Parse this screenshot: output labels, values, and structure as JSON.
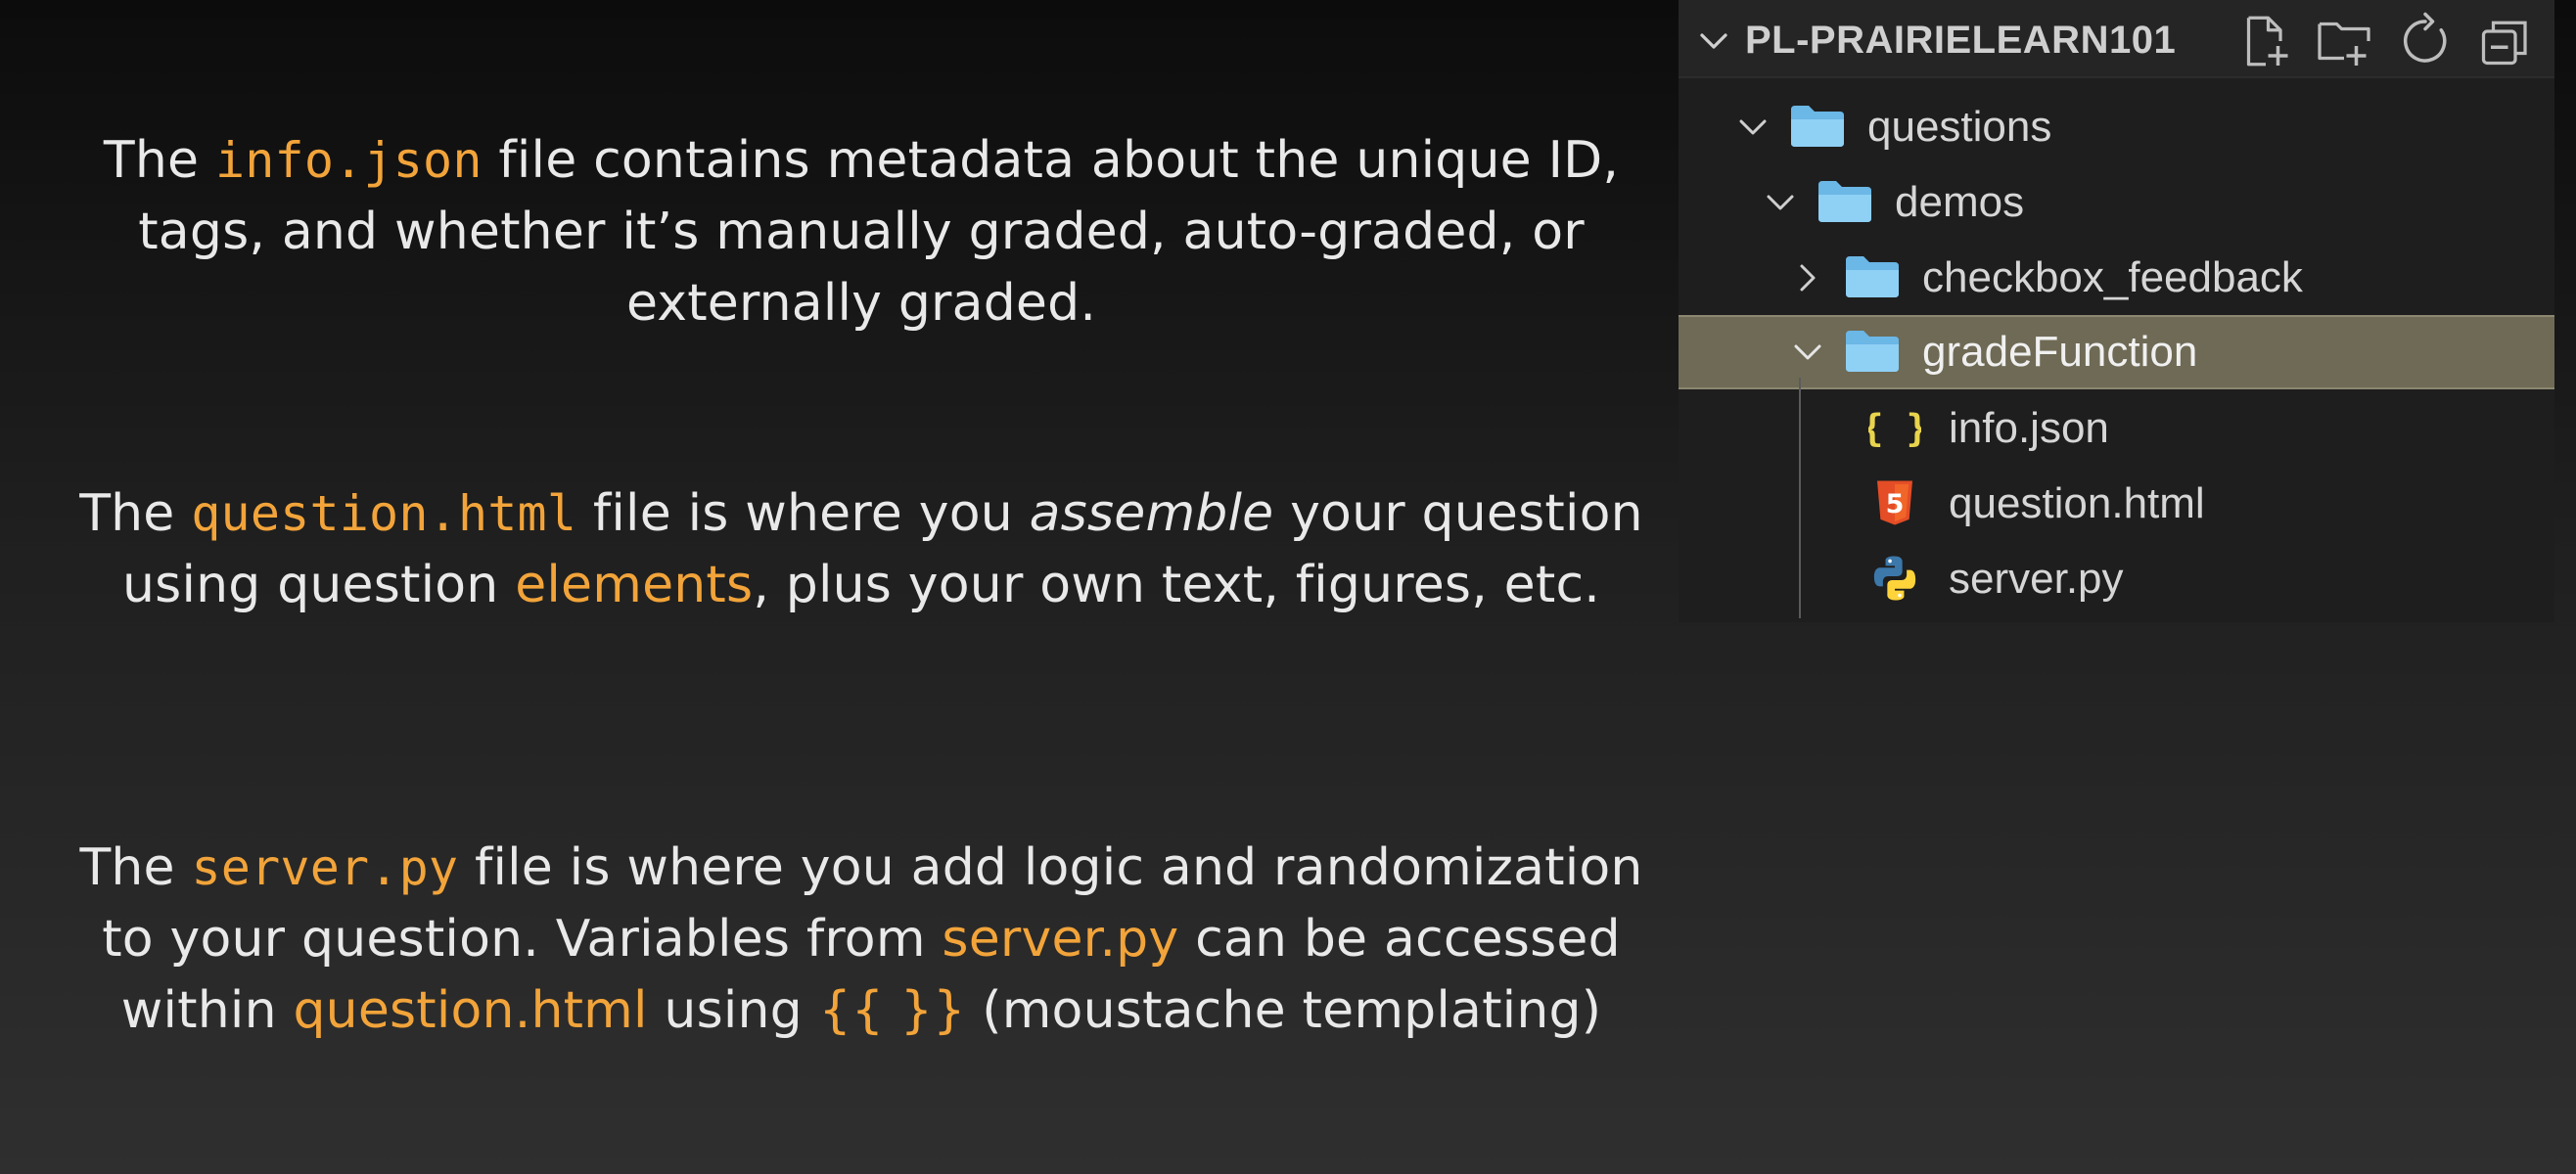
{
  "slide": {
    "info": {
      "p1": "The ",
      "code": "info.json",
      "p2": " file contains metadata about the unique ID,",
      "line2": "tags, and whether it’s manually graded, auto-graded, or",
      "line3": "externally graded."
    },
    "question": {
      "p1": "The ",
      "code": "question.html",
      "p2": " file is where you ",
      "em": "assemble",
      "p3": " your question",
      "l2a": "using question ",
      "l2link": "elements",
      "l2b": ", plus your own text, figures, etc."
    },
    "server": {
      "p1": "The ",
      "code": "server.py",
      "p2": " file is where you add logic and randomization",
      "l2a": "to your question. Variables from ",
      "l2acc": "server.py",
      "l2b": " can be accessed",
      "l3a": "within ",
      "l3acc": "question.html",
      "l3b": " using ",
      "l3acc2": "{{ }}",
      "l3c": " (moustache templating)"
    }
  },
  "explorer": {
    "title": "PL-PRAIRIELEARN101",
    "actions": [
      "new-file-icon",
      "new-folder-icon",
      "refresh-icon",
      "collapse-all-icon"
    ],
    "tree": [
      {
        "label": "questions",
        "type": "folder",
        "expanded": true
      },
      {
        "label": "demos",
        "type": "folder",
        "expanded": true
      },
      {
        "label": "checkbox_feedback",
        "type": "folder",
        "expanded": false
      },
      {
        "label": "gradeFunction",
        "type": "folder",
        "expanded": true,
        "selected": true
      },
      {
        "label": "info.json",
        "type": "json-file"
      },
      {
        "label": "question.html",
        "type": "html-file"
      },
      {
        "label": "server.py",
        "type": "python-file"
      }
    ]
  },
  "colors": {
    "accent": "#f2a43a",
    "selection": "#6e6a55",
    "folder": "#7ec8f0",
    "json": "#e8d44d",
    "html5": "#e44d26"
  }
}
